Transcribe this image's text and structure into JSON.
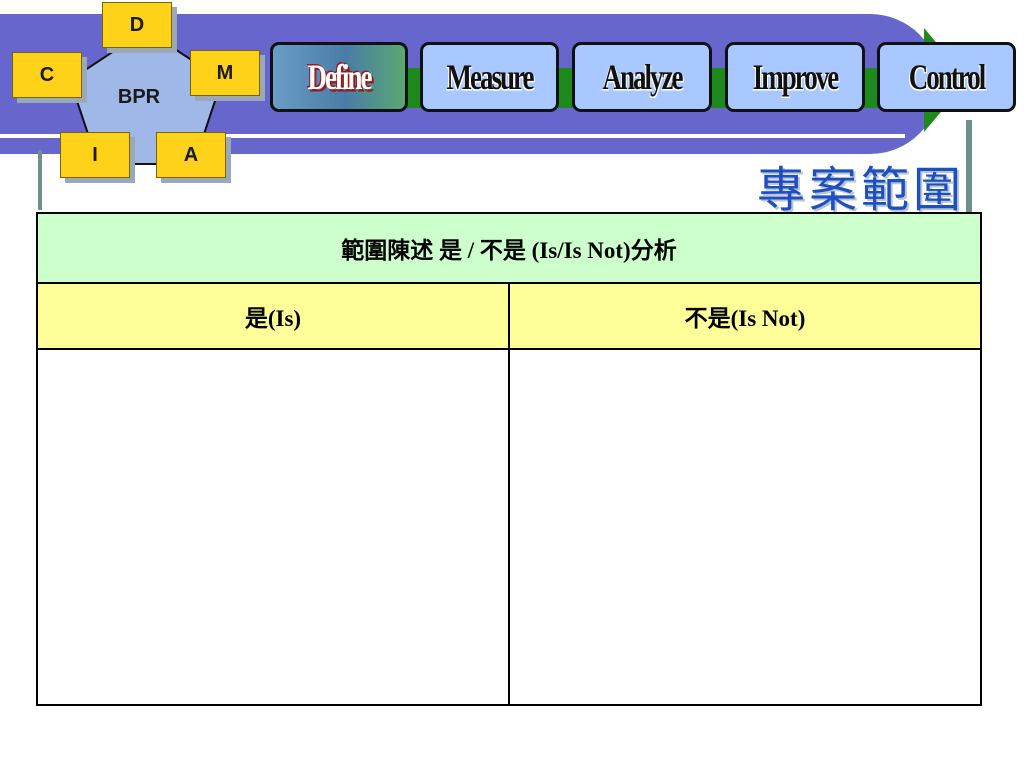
{
  "bpr": {
    "center_label": "BPR",
    "nodes": [
      "D",
      "M",
      "A",
      "I",
      "C"
    ]
  },
  "tabs": [
    {
      "label": "Define",
      "active": true
    },
    {
      "label": "Measure",
      "active": false
    },
    {
      "label": "Analyze",
      "active": false
    },
    {
      "label": "Improve",
      "active": false
    },
    {
      "label": "Control",
      "active": false
    }
  ],
  "page_title": "專案範圍",
  "table": {
    "heading": "範圍陳述 是 / 不是 (Is/Is Not)分析",
    "columns": [
      "是(Is)",
      "不是(Is Not)"
    ],
    "cells": [
      "",
      ""
    ]
  },
  "colors": {
    "banner": "#6666cc",
    "stripe": "#1e8a1e",
    "tab": "#a8c8ff",
    "node": "#ffd21a",
    "title": "#1e4fbf",
    "table_heading_bg": "#ccffcc",
    "table_columns_bg": "#ffff99"
  }
}
